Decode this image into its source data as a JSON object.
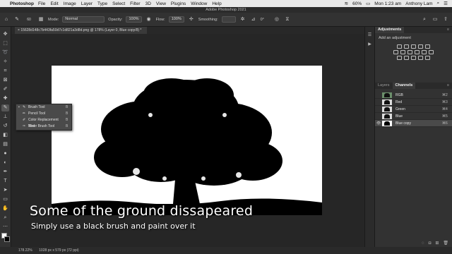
{
  "menubar": {
    "app": "Photoshop",
    "items": [
      "File",
      "Edit",
      "Image",
      "Layer",
      "Type",
      "Select",
      "Filter",
      "3D",
      "View",
      "Plugins",
      "Window",
      "Help"
    ],
    "battery": "60%",
    "clock": "Mon 1:23 am",
    "user": "Anthony Lam"
  },
  "window": {
    "title": "Adobe Photoshop 2021"
  },
  "options": {
    "brush_size": "60",
    "mode_label": "Mode:",
    "mode_value": "Normal",
    "opacity_label": "Opacity:",
    "opacity_value": "100%",
    "flow_label": "Flow:",
    "flow_value": "100%",
    "smoothing_label": "Smoothing:",
    "angle_value": "0°"
  },
  "document": {
    "tab_title": "15628d148c7b443fa50d7c1d821a3d8d.png @ 178% (Layer 0, Blue copy/8) *"
  },
  "flyout": [
    {
      "label": "Brush Tool",
      "key": "B",
      "checked": true
    },
    {
      "label": "Pencil Tool",
      "key": "B",
      "checked": false
    },
    {
      "label": "Color Replacement Tool",
      "key": "B",
      "checked": false
    },
    {
      "label": "Mixer Brush Tool",
      "key": "B",
      "checked": false
    }
  ],
  "adjustments": {
    "tab": "Adjustments",
    "hint": "Add an adjustment"
  },
  "layers_panel": {
    "tabs": [
      "Layers",
      "Channels"
    ],
    "active_tab": "Channels",
    "channels": [
      {
        "name": "RGB",
        "key": "⌘2"
      },
      {
        "name": "Red",
        "key": "⌘3"
      },
      {
        "name": "Green",
        "key": "⌘4"
      },
      {
        "name": "Blue",
        "key": "⌘5"
      },
      {
        "name": "Blue copy",
        "key": "⌘6"
      }
    ]
  },
  "status": {
    "zoom": "178.22%",
    "doc_size": "1028 px x 579 px (72 ppi)"
  },
  "captions": {
    "headline": "Some of the ground dissapeared",
    "subline": "Simply use a black brush and paint over it"
  },
  "colors": {
    "ui_dark": "#323232",
    "canvas": "#ffffff",
    "silhouette": "#000000"
  }
}
